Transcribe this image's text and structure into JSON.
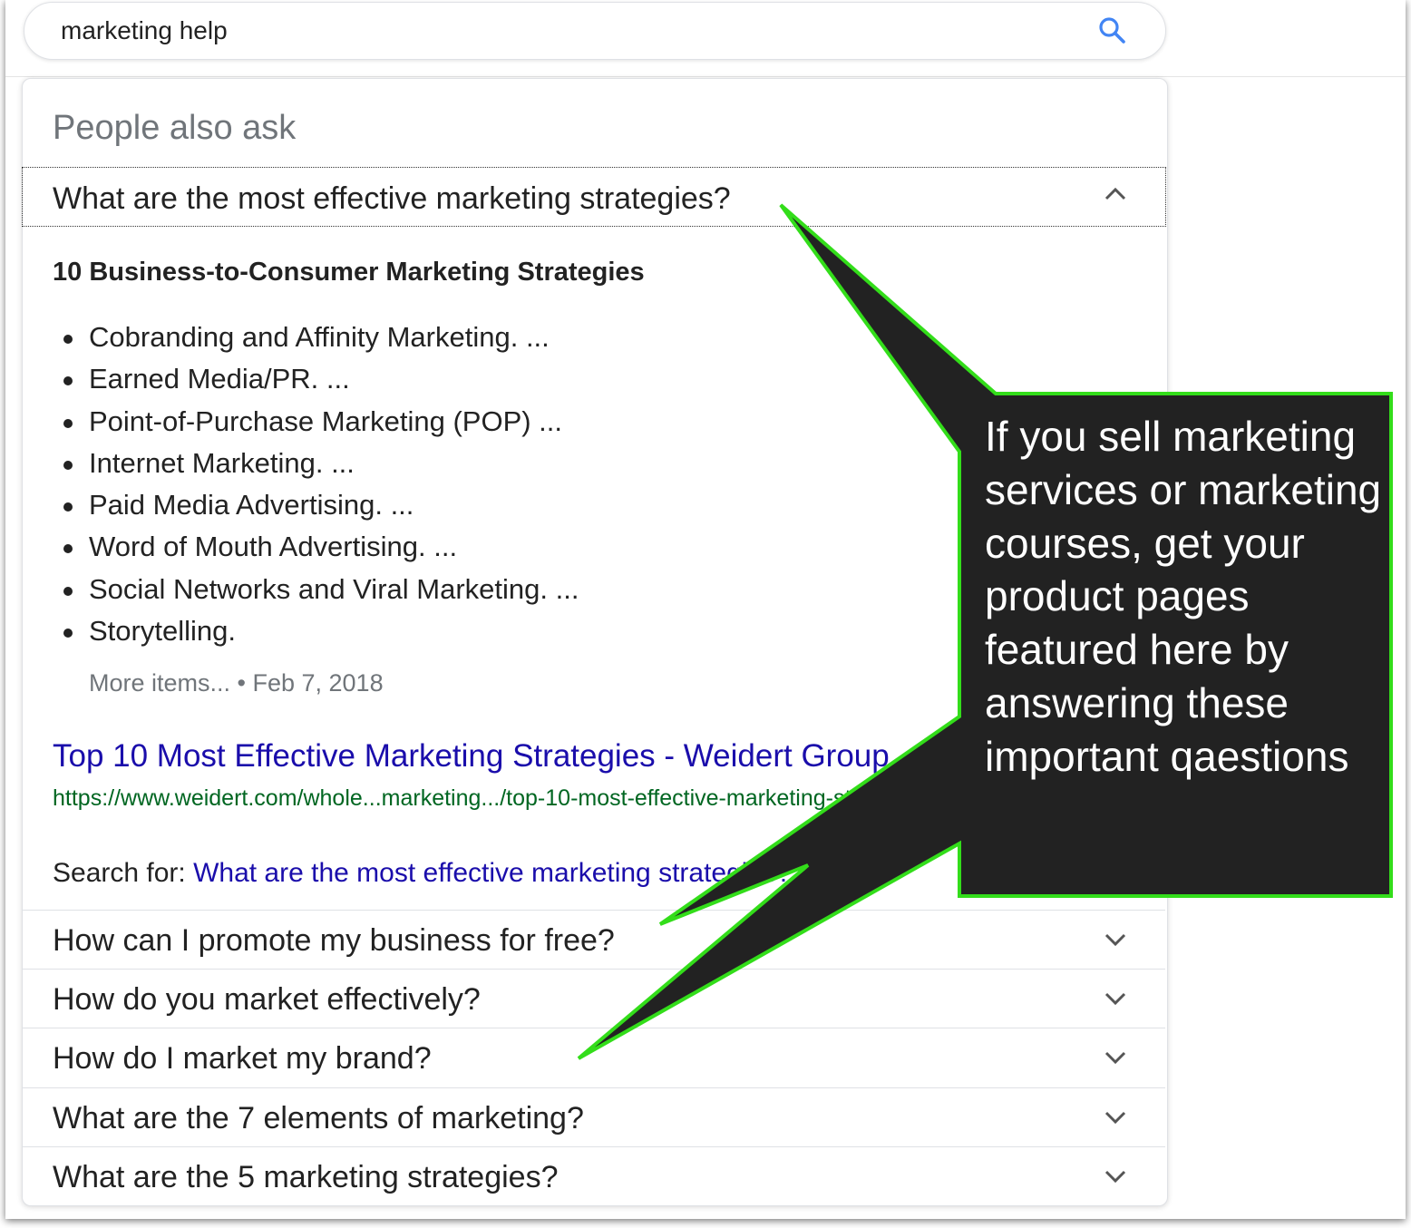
{
  "search": {
    "query": "marketing help"
  },
  "paa": {
    "title": "People also ask",
    "expanded_question": "What are the most effective marketing strategies?",
    "answer": {
      "heading": "10 Business-to-Consumer Marketing Strategies",
      "items": [
        "Cobranding and Affinity Marketing. ...",
        "Earned Media/PR. ...",
        "Point-of-Purchase Marketing (POP) ...",
        "Internet Marketing. ...",
        "Paid Media Advertising. ...",
        "Word of Mouth Advertising. ...",
        "Social Networks and Viral Marketing. ...",
        "Storytelling."
      ],
      "more_items": "More items... • Feb 7, 2018",
      "result_title": "Top 10 Most Effective Marketing Strategies - Weidert Group",
      "result_url": "https://www.weidert.com/whole...marketing.../top-10-most-effective-marketing-strategies",
      "search_for_label": "Search for: ",
      "search_for_link": "What are the most effective marketing strategies?"
    },
    "questions": [
      "How can I promote my business for free?",
      "How do you market effectively?",
      "How do I market my brand?",
      "What are the 7 elements of marketing?",
      "What are the 5 marketing strategies?"
    ]
  },
  "callout": {
    "text": "If you sell marketing services or marketing courses, get your product pages featured here by answering these important qaestions",
    "fill_color": "#222222",
    "border_color": "#33dd1a"
  },
  "colors": {
    "link": "#1a0dab",
    "url": "#006621",
    "muted": "#70757a",
    "search_icon": "#4285f4"
  }
}
